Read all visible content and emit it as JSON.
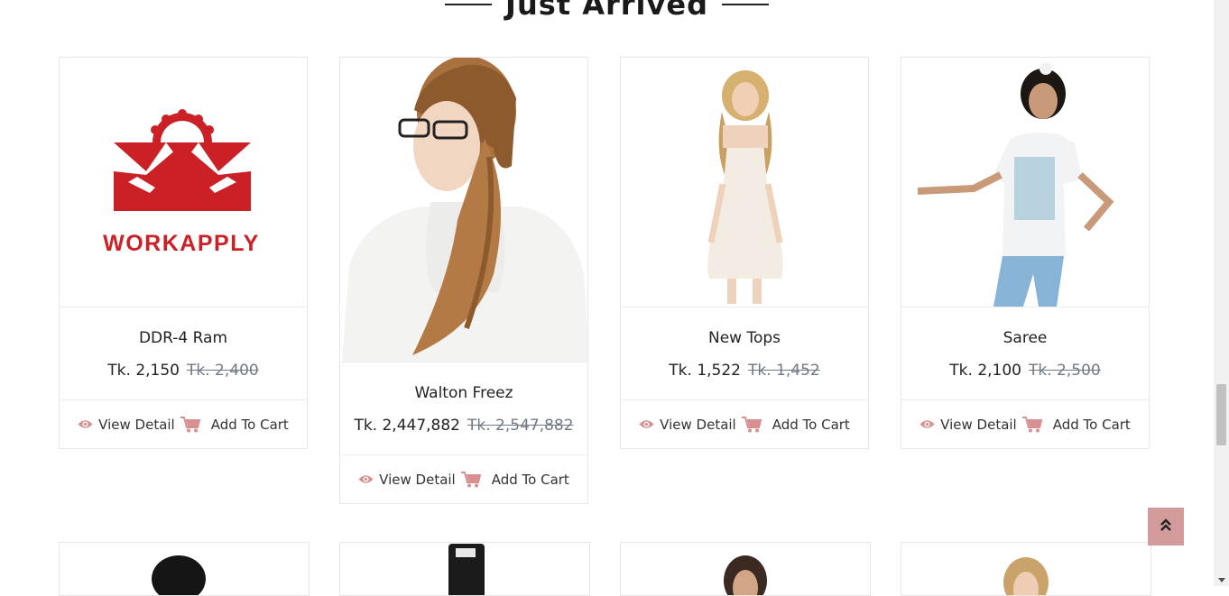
{
  "section": {
    "title": "Just Arrived"
  },
  "products": [
    {
      "name": "DDR-4 Ram",
      "price": "Tk. 2,150",
      "old_price": "Tk. 2,400",
      "view_label": "View Detail",
      "cart_label": "Add To Cart",
      "logo_text": "WORKAPPLY"
    },
    {
      "name": "Walton Freez",
      "price": "Tk. 2,447,882",
      "old_price": "Tk. 2,547,882",
      "view_label": "View Detail",
      "cart_label": "Add To Cart"
    },
    {
      "name": "New Tops",
      "price": "Tk. 1,522",
      "old_price": "Tk. 1,452",
      "view_label": "View Detail",
      "cart_label": "Add To Cart"
    },
    {
      "name": "Saree",
      "price": "Tk. 2,100",
      "old_price": "Tk. 2,500",
      "view_label": "View Detail",
      "cart_label": "Add To Cart"
    }
  ],
  "colors": {
    "accent": "#d39b9b",
    "icon": "#d88f8f",
    "logo_red": "#cc2027"
  }
}
